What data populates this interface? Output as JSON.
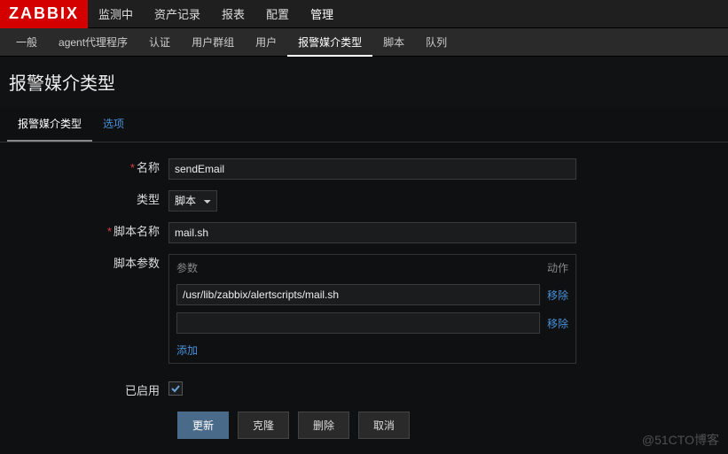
{
  "logo": "ZABBIX",
  "topnav": [
    "监测中",
    "资产记录",
    "报表",
    "配置",
    "管理"
  ],
  "topnav_active": 4,
  "subnav": [
    "一般",
    "agent代理程序",
    "认证",
    "用户群组",
    "用户",
    "报警媒介类型",
    "脚本",
    "队列"
  ],
  "subnav_active": 5,
  "page_title": "报警媒介类型",
  "tabs": {
    "main": "报警媒介类型",
    "options": "选项"
  },
  "form": {
    "name_label": "名称",
    "name_value": "sendEmail",
    "type_label": "类型",
    "type_value": "脚本",
    "script_label": "脚本名称",
    "script_value": "mail.sh",
    "params_label": "脚本参数",
    "params_head_col1": "参数",
    "params_head_col2": "动作",
    "params": [
      {
        "value": "/usr/lib/zabbix/alertscripts/mail.sh"
      },
      {
        "value": ""
      }
    ],
    "remove_label": "移除",
    "add_label": "添加",
    "enabled_label": "已启用",
    "enabled": true
  },
  "buttons": {
    "update": "更新",
    "clone": "克隆",
    "delete": "删除",
    "cancel": "取消"
  },
  "watermark": "@51CTO博客"
}
